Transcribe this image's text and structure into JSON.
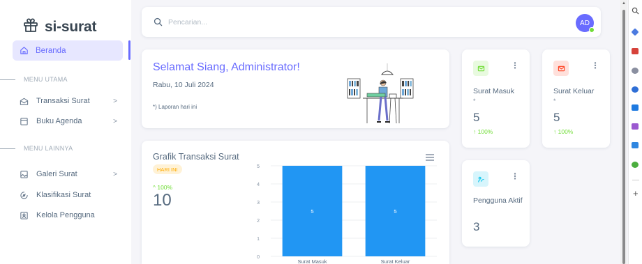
{
  "app": {
    "name": "si-surat"
  },
  "sidebar": {
    "active": {
      "label": "Beranda"
    },
    "sections": [
      {
        "title": "MENU UTAMA",
        "items": [
          {
            "label": "Transaksi Surat",
            "has_submenu": true
          },
          {
            "label": "Buku Agenda",
            "has_submenu": true
          }
        ]
      },
      {
        "title": "MENU LAINNYA",
        "items": [
          {
            "label": "Galeri Surat",
            "has_submenu": true
          },
          {
            "label": "Klasifikasi Surat",
            "has_submenu": false
          },
          {
            "label": "Kelola Pengguna",
            "has_submenu": false
          }
        ]
      }
    ],
    "chevron": ">"
  },
  "topbar": {
    "search_placeholder": "Pencarian...",
    "avatar_initials": "AD"
  },
  "welcome": {
    "greeting": "Selamat Siang, Administrator!",
    "date": "Rabu, 10 Juli 2024",
    "note": "*) Laporan hari ini"
  },
  "stats": {
    "surat_masuk": {
      "title": "Surat Masuk",
      "star": "*",
      "value": "5",
      "change": "↑ 100%",
      "icon": "mail-in-icon"
    },
    "surat_keluar": {
      "title": "Surat Keluar",
      "star": "*",
      "value": "5",
      "change": "↑ 100%",
      "icon": "mail-out-icon"
    },
    "pengguna": {
      "title": "Pengguna Aktif",
      "value": "3",
      "icon": "user-icon"
    },
    "menu_glyph": "⋮"
  },
  "chart_card": {
    "title": "Grafik Transaksi Surat",
    "badge": "HARI INI",
    "change": "^ 100%",
    "total": "10"
  },
  "chart_data": {
    "type": "bar",
    "categories": [
      "Surat Masuk",
      "Surat Keluar"
    ],
    "values": [
      5,
      5
    ],
    "ylim": [
      0,
      5
    ],
    "yticks": [
      0,
      1,
      2,
      3,
      4,
      5
    ],
    "grid": true,
    "bar_color": "#2196f3"
  },
  "colors": {
    "primary": "#696cff",
    "success": "#71dd37",
    "warning": "#ffab00",
    "danger": "#ff3e1d",
    "info": "#03c3ec"
  }
}
